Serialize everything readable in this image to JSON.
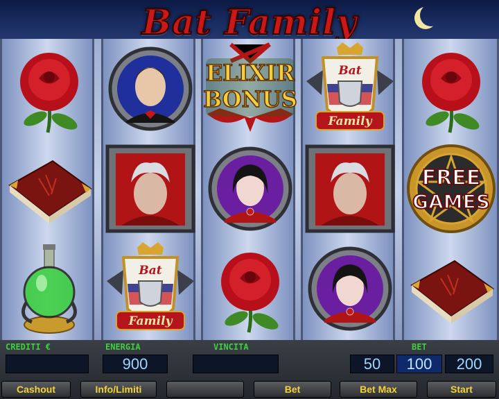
{
  "game": {
    "title": "Bat Family"
  },
  "reels": [
    [
      "rose",
      "book",
      "elixir-potion"
    ],
    [
      "vampire-son",
      "vampire-count",
      "bat-family-crest"
    ],
    [
      "elixir-bonus",
      "vampire-girl",
      "rose"
    ],
    [
      "bat-family-crest",
      "vampire-count",
      "vampire-girl"
    ],
    [
      "rose",
      "free-games",
      "book"
    ]
  ],
  "symbols": {
    "elixir_bonus_line1": "ELIXIR",
    "elixir_bonus_line2": "BONUS",
    "free_games_line1": "FREE",
    "free_games_line2": "GAMES",
    "crest_line1": "Bat",
    "crest_line2": "Family"
  },
  "panel": {
    "crediti_label": "CREDITI €",
    "crediti_value": "",
    "energia_label": "ENERGIA",
    "energia_value": "900",
    "vincita_label": "VINCITA",
    "vincita_value": "",
    "bet_label": "BET",
    "bet_options": [
      "50",
      "100",
      "200"
    ],
    "bet_selected": "100"
  },
  "buttons": {
    "cashout": "Cashout",
    "info": "Info/Limiti",
    "blank": "",
    "bet": "Bet",
    "bet_max": "Bet Max",
    "start": "Start"
  },
  "colors": {
    "title_red": "#c81818",
    "label_green": "#3fd03f",
    "button_text": "#f5d23a",
    "value_blue": "#9fd6ff"
  }
}
